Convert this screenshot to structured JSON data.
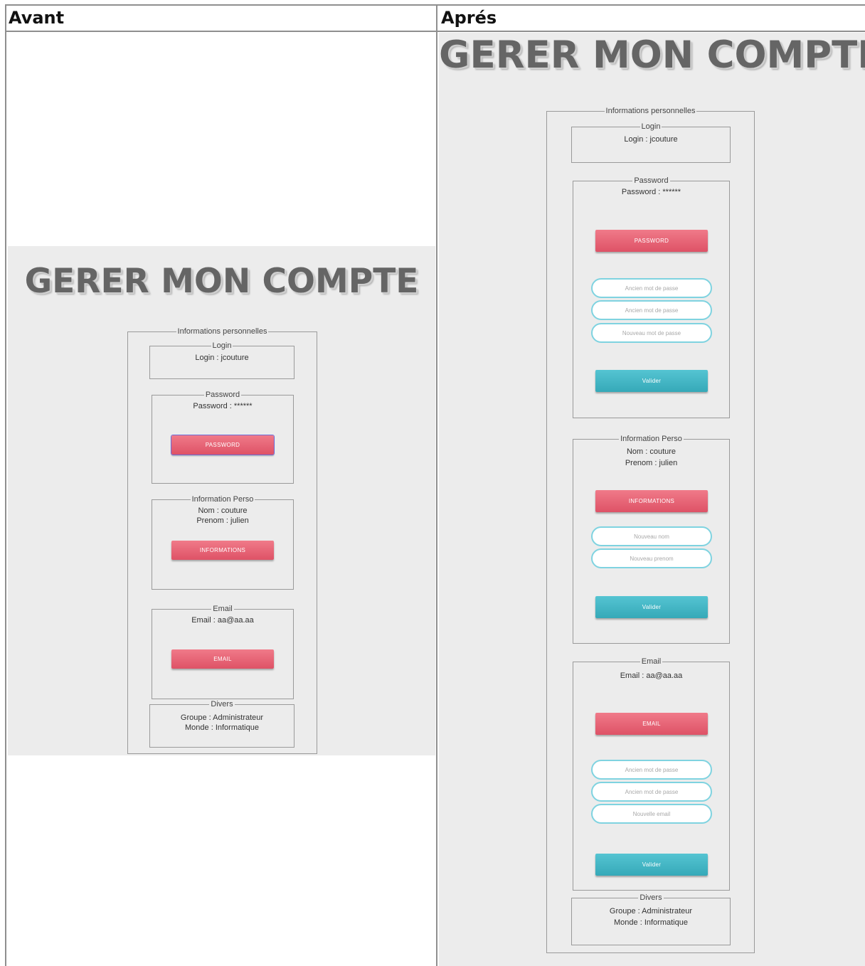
{
  "table": {
    "col_before": "Avant",
    "col_after": "Aprés"
  },
  "before": {
    "title": "GERER MON COMPTE",
    "outer_legend": "Informations personnelles",
    "login": {
      "legend": "Login",
      "text": "Login : jcouture"
    },
    "password": {
      "legend": "Password",
      "text": "Password : ******",
      "button": "PASSWORD"
    },
    "info": {
      "legend": "Information Perso",
      "nom": "Nom : couture",
      "prenom": "Prenom : julien",
      "button": "INFORMATIONS"
    },
    "email": {
      "legend": "Email",
      "text": "Email : aa@aa.aa",
      "button": "EMAIL"
    },
    "divers": {
      "legend": "Divers",
      "groupe": "Groupe : Administrateur",
      "monde": "Monde : Informatique"
    }
  },
  "after": {
    "title": "GERER MON COMPTE",
    "outer_legend": "Informations personnelles",
    "login": {
      "legend": "Login",
      "text": "Login : jcouture"
    },
    "password": {
      "legend": "Password",
      "text": "Password : ******",
      "button": "PASSWORD",
      "input1_placeholder": "Ancien mot de passe",
      "input2_placeholder": "Ancien mot de passe",
      "input3_placeholder": "Nouveau mot de passe",
      "submit": "Valider"
    },
    "info": {
      "legend": "Information Perso",
      "nom": "Nom : couture",
      "prenom": "Prenom : julien",
      "button": "INFORMATIONS",
      "input1_placeholder": "Nouveau nom",
      "input2_placeholder": "Nouveau prenom",
      "submit": "Valider"
    },
    "email": {
      "legend": "Email",
      "text": "Email : aa@aa.aa",
      "button": "EMAIL",
      "input1_placeholder": "Ancien mot de passe",
      "input2_placeholder": "Ancien mot de passe",
      "input3_placeholder": "Nouvelle email",
      "submit": "Valider"
    },
    "divers": {
      "legend": "Divers",
      "groupe": "Groupe : Administrateur",
      "monde": "Monde : Informatique"
    }
  },
  "colors": {
    "panel_bg": "#ececec",
    "button_red": "#e45b6f",
    "button_teal": "#3fb3c1",
    "input_border": "#7fd3e0",
    "title_gray": "#656565"
  }
}
